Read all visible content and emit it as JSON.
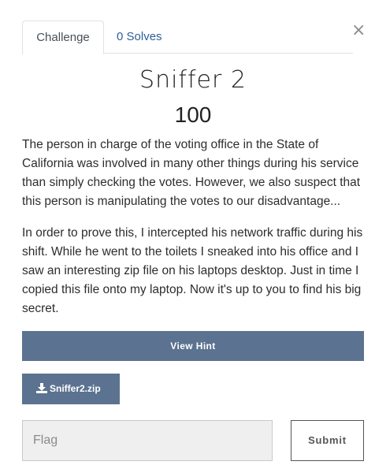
{
  "modal": {
    "close_symbol": "×",
    "tabs": [
      {
        "label": "Challenge"
      },
      {
        "label": "0 Solves"
      }
    ],
    "challenge": {
      "name": "Sniffer 2",
      "value": "100",
      "description": [
        "The person in charge of the voting office in the State of California was involved in many other things during his service than simply checking the votes. However, we also suspect that this person is manipulating the votes to our disadvantage...",
        "In order to prove this, I intercepted his network traffic during his shift. While he went to the toilets I sneaked into his office and I saw an interesting zip file on his laptops desktop. Just in time I copied this file onto my laptop. Now it's up to you to find his big secret."
      ],
      "hint_label": "View Hint",
      "file": {
        "label": "Sniffer2.zip",
        "icon": "download-icon"
      },
      "flag_placeholder": "Flag",
      "submit_label": "Submit"
    }
  }
}
